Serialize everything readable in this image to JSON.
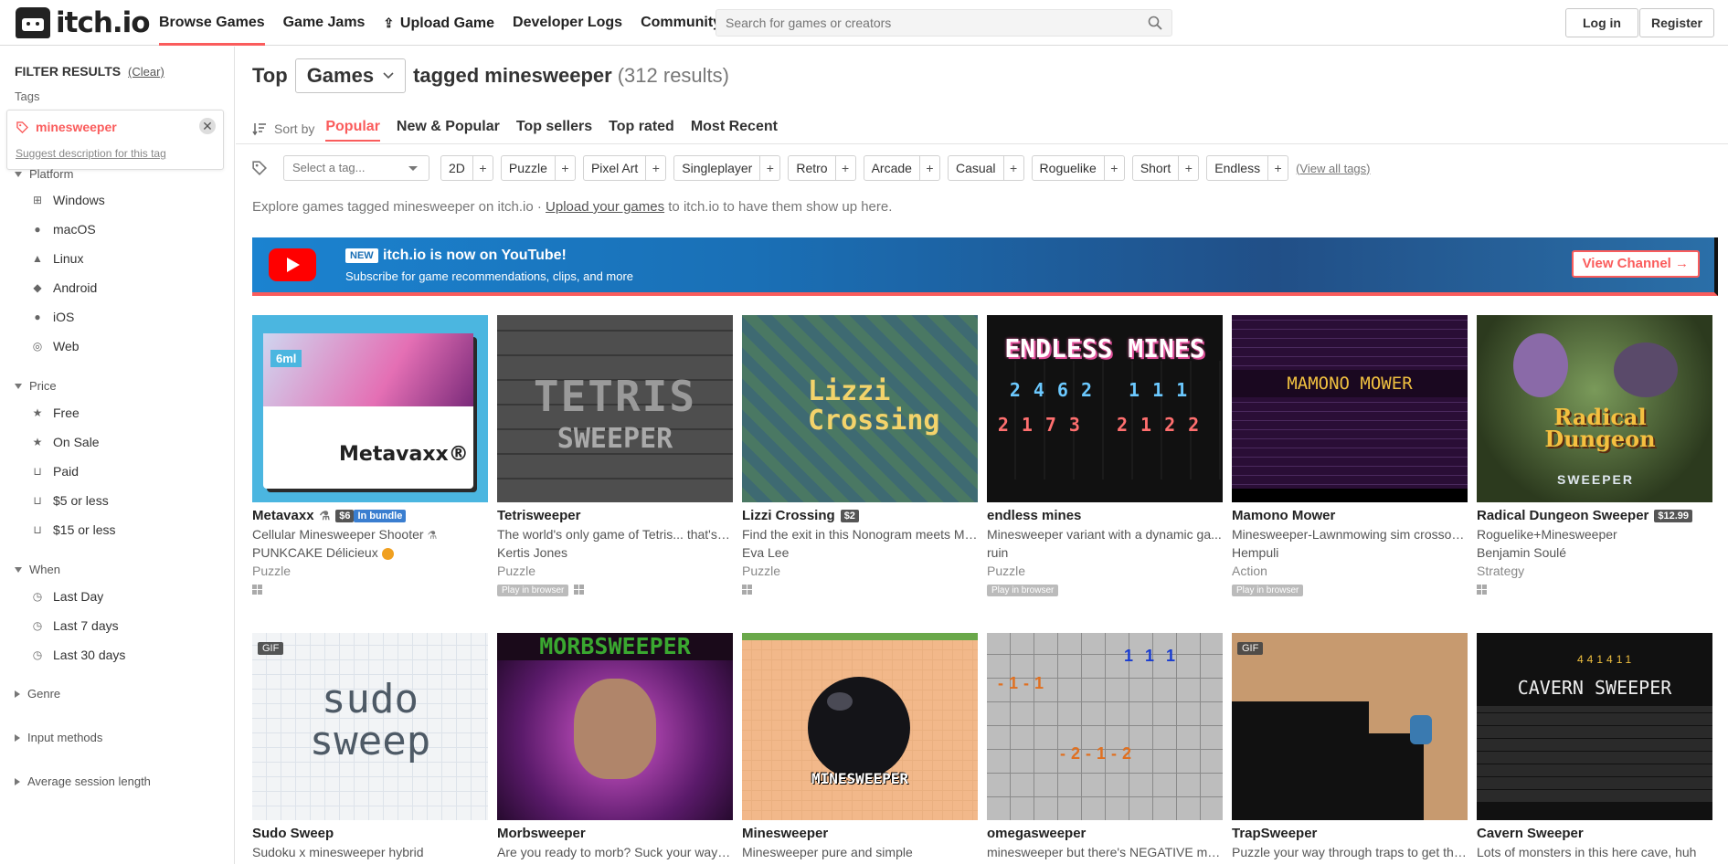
{
  "header": {
    "logo_text": "itch.io",
    "nav": [
      "Browse Games",
      "Game Jams",
      "Upload Game",
      "Developer Logs",
      "Community"
    ],
    "search_placeholder": "Search for games or creators",
    "login": "Log in",
    "register": "Register"
  },
  "sidebar": {
    "filter_title": "FILTER RESULTS",
    "clear": "(Clear)",
    "tags_label": "Tags",
    "selected_tag": "minesweeper",
    "suggest": "Suggest description for this tag",
    "platform_label": "Platform",
    "platforms": [
      "Windows",
      "macOS",
      "Linux",
      "Android",
      "iOS",
      "Web"
    ],
    "price_label": "Price",
    "prices": [
      "Free",
      "On Sale",
      "Paid",
      "$5 or less",
      "$15 or less"
    ],
    "when_label": "When",
    "whens": [
      "Last Day",
      "Last 7 days",
      "Last 30 days"
    ],
    "genre_label": "Genre",
    "input_label": "Input methods",
    "session_label": "Average session length"
  },
  "main": {
    "top": "Top",
    "games_select": "Games",
    "tagged": "tagged minesweeper",
    "results": "(312 results)",
    "sort_by": "Sort by",
    "sort_tabs": [
      "Popular",
      "New & Popular",
      "Top sellers",
      "Top rated",
      "Most Recent"
    ],
    "tag_placeholder": "Select a tag...",
    "tags": [
      "2D",
      "Puzzle",
      "Pixel Art",
      "Singleplayer",
      "Retro",
      "Arcade",
      "Casual",
      "Roguelike",
      "Short",
      "Endless"
    ],
    "view_all": "(View all tags)",
    "explore_pre": "Explore games tagged minesweeper on itch.io · ",
    "explore_link": "Upload your games",
    "explore_post": " to itch.io to have them show up here.",
    "yt_new": "NEW",
    "yt_title": "itch.io is now on YouTube!",
    "yt_sub": "Subscribe for game recommendations, clips, and more",
    "yt_button": "View Channel →"
  },
  "games": [
    {
      "title": "Metavaxx",
      "price": "$6",
      "bundle": "In bundle",
      "desc": "Cellular Minesweeper Shooter",
      "author": "PUNKCAKE Délicieux",
      "genre": "Puzzle",
      "browser": "",
      "art": "Metavaxx®"
    },
    {
      "title": "Tetrisweeper",
      "desc": "The world's only game of Tetris... that's a...",
      "author": "Kertis Jones",
      "genre": "Puzzle",
      "browser": "Play in browser",
      "art": "TETRIS"
    },
    {
      "title": "Lizzi Crossing",
      "price": "$2",
      "desc": "Find the exit in this Nonogram meets Mi...",
      "author": "Eva Lee",
      "genre": "Puzzle",
      "browser": "",
      "art": "Lizzi Crossing"
    },
    {
      "title": "endless mines",
      "desc": "Minesweeper variant with a dynamic ga...",
      "author": "ruin",
      "genre": "Puzzle",
      "browser": "Play in browser",
      "art": "ENDLESS MINES"
    },
    {
      "title": "Mamono Mower",
      "desc": "Minesweeper-Lawnmowing sim crossov...",
      "author": "Hempuli",
      "genre": "Action",
      "browser": "Play in browser",
      "art": "MAMONO MOWER"
    },
    {
      "title": "Radical Dungeon Sweeper",
      "price": "$12.99",
      "desc": "Roguelike+Minesweeper",
      "author": "Benjamin Soulé",
      "genre": "Strategy",
      "browser": "",
      "art": "Radical Dungeon"
    },
    {
      "title": "Sudo Sweep",
      "desc": "Sudoku x minesweeper hybrid",
      "gif": "GIF",
      "art": "sudo sweep"
    },
    {
      "title": "Morbsweeper",
      "desc": "Are you ready to morb? Suck your way t...",
      "art": "MORBSWEEPER"
    },
    {
      "title": "Minesweeper",
      "desc": "Minesweeper pure and simple",
      "art": "MINESWEEPER"
    },
    {
      "title": "omegasweeper",
      "desc": "minesweeper but there's NEGATIVE min..."
    },
    {
      "title": "TrapSweeper",
      "desc": "Puzzle your way through traps to get the...",
      "gif": "GIF"
    },
    {
      "title": "Cavern Sweeper",
      "desc": "Lots of monsters in this here cave, huh",
      "art": "CAVERN SWEEPER"
    }
  ],
  "colors": {
    "accent": "#fa5c5c",
    "youtube": "#ff0000"
  }
}
